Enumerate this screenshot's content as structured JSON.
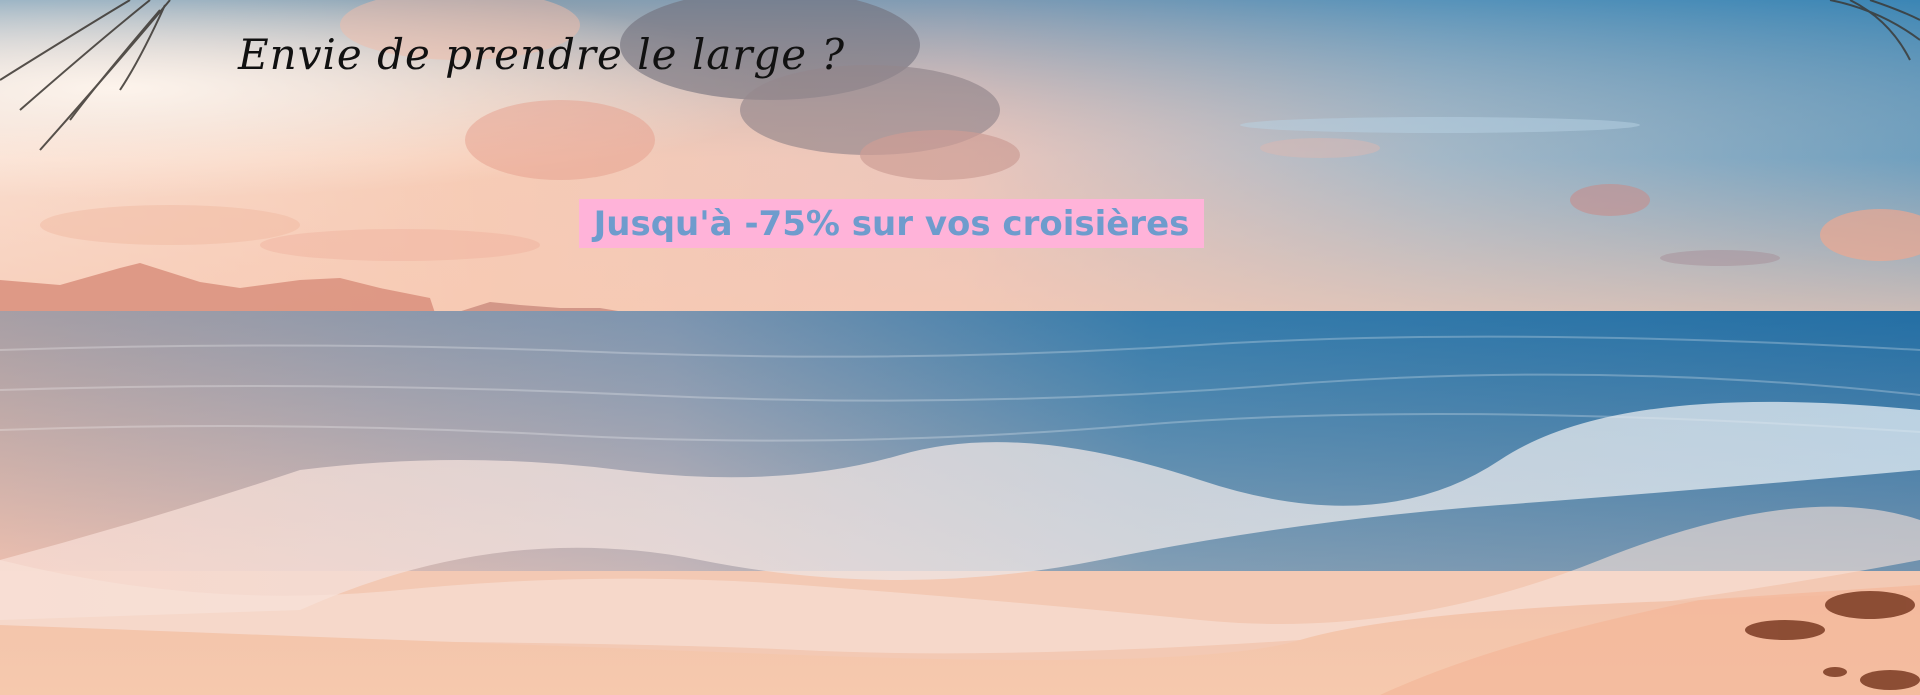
{
  "banner": {
    "tagline": "Envie de prendre le large ?",
    "promo_label": "Jusqu'à -75% sur vos croisières",
    "background": "beach-sunset-photo"
  },
  "colors": {
    "tagline_text": "#111111",
    "promo_background": "#ffb3d9",
    "promo_text": "#6e9ccd",
    "sky_top": "#3b86b3",
    "sky_warm": "#f7d5c0",
    "sea": "#2f7bb0",
    "sand": "#f0c0a4"
  }
}
